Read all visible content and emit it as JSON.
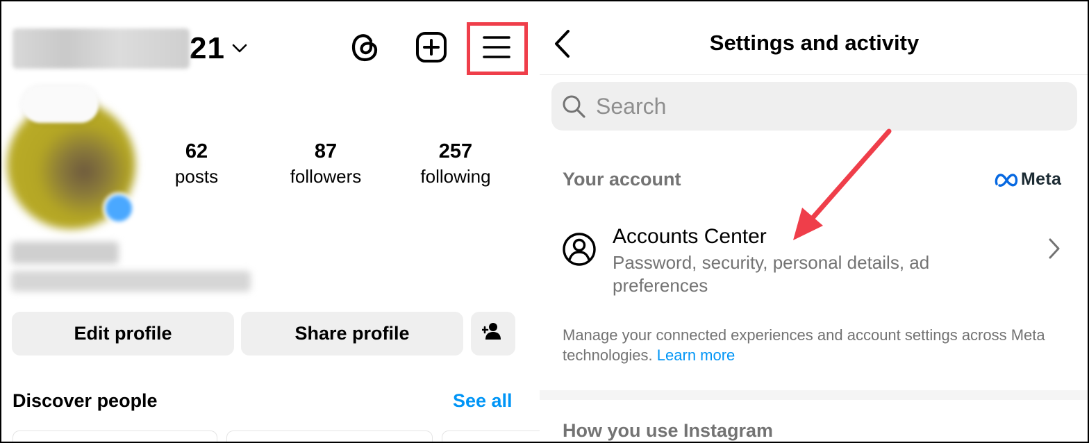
{
  "profile": {
    "username_suffix": "21",
    "stats": [
      {
        "value": "62",
        "label": "posts"
      },
      {
        "value": "87",
        "label": "followers"
      },
      {
        "value": "257",
        "label": "following"
      }
    ],
    "buttons": {
      "edit": "Edit profile",
      "share": "Share profile"
    },
    "discover": {
      "title": "Discover people",
      "see_all": "See all"
    },
    "icons": [
      "chevron-down-icon",
      "threads-icon",
      "create-post-icon",
      "hamburger-menu-icon",
      "add-person-icon"
    ]
  },
  "settings": {
    "title": "Settings and activity",
    "search_placeholder": "Search",
    "your_account_label": "Your account",
    "meta_brand": "Meta",
    "accounts_center": {
      "title": "Accounts Center",
      "subtitle": "Password, security, personal details, ad preferences"
    },
    "manage_text": "Manage your connected experiences and account settings across Meta technologies.",
    "learn_more": "Learn more",
    "how_you_use_label": "How you use Instagram"
  },
  "colors": {
    "link_blue": "#0095f6",
    "highlight_red": "#ef3e4a",
    "button_gray": "#efefef",
    "secondary_text": "#737373"
  }
}
